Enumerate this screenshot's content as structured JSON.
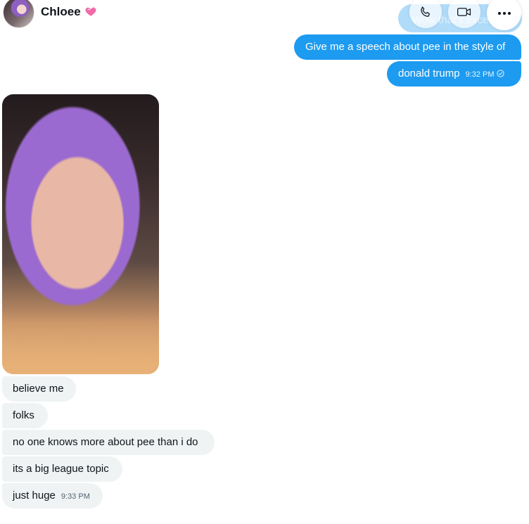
{
  "header": {
    "contact_name": "Chloee",
    "heart_icon": "sparkling-heart-icon",
    "ghost_text": "Wow that's excell"
  },
  "actions": {
    "call_icon": "phone-icon",
    "video_icon": "video-icon",
    "more_icon": "more-icon"
  },
  "outgoing": [
    {
      "text": "Give me a speech about pee in the style of"
    },
    {
      "text": "donald trump",
      "time": "9:32 PM",
      "status_icon": "sent-check-icon"
    }
  ],
  "incoming_photo": {
    "description_icon": "photo"
  },
  "incoming": [
    {
      "text": "believe me"
    },
    {
      "text": "folks"
    },
    {
      "text": "no one knows more about pee than i do"
    },
    {
      "text": "its a big league topic"
    },
    {
      "text": "just huge",
      "time": "9:33 PM"
    }
  ],
  "colors": {
    "accent": "#1d9bf0",
    "incoming_bg": "#eff3f4",
    "text": "#0f1419",
    "muted": "#536471"
  }
}
